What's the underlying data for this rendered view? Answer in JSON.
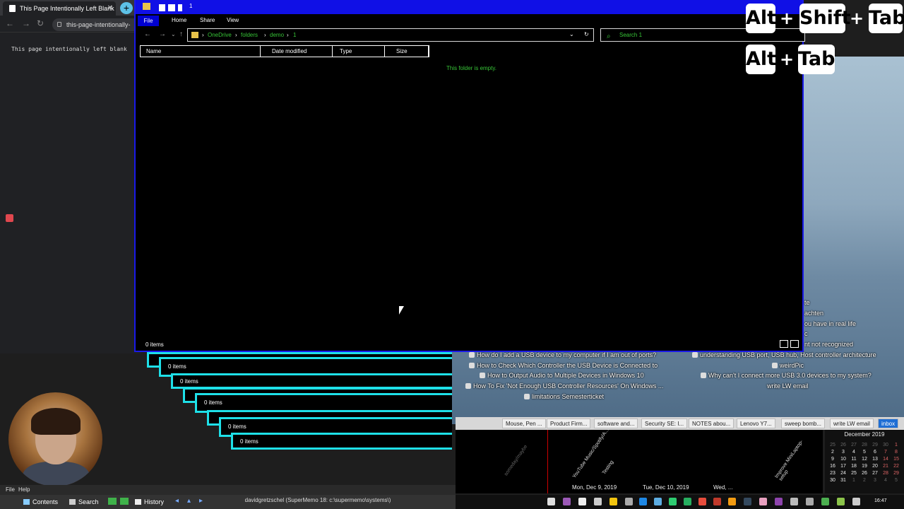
{
  "browser": {
    "tab_title": "This Page Intentionally Left Blank",
    "new_tab_symbol": "+",
    "url": "this-page-intentionally-",
    "content_text": "This page intentionally left blank"
  },
  "explorer": {
    "title_number": "1",
    "ribbon_tabs": [
      "File",
      "Home",
      "Share",
      "View"
    ],
    "breadcrumb": [
      "OneDrive",
      "folders",
      "demo",
      "1"
    ],
    "search_placeholder": "Search 1",
    "columns": [
      "Name",
      "Date modified",
      "Type",
      "Size"
    ],
    "empty_message": "This folder is empty.",
    "status": "0 items"
  },
  "cascade_status": [
    "0 items",
    "0 items",
    "0 items",
    "0 items",
    "0 items"
  ],
  "key_overlay": {
    "row1": [
      "Alt",
      "+",
      "Shift",
      "+",
      "Tab"
    ],
    "row2": [
      "Alt",
      "+",
      "Tab"
    ]
  },
  "wallpaper_links": [
    "How do I add a USB device to my computer if I am out of ports?",
    "How to Check Which Controller the USB Device is Connected to",
    "How to Output Audio to Multiple Devices in Windows 10",
    "How To Fix 'Not Enough USB Controller Resources' On Windows ...",
    "limitations Semesterticket",
    "understanding USB port, USB hub, Host controller architecture",
    "weirdPic",
    "Why can't I connect more USB 3.0 devices to my system?",
    "write LW email",
    "te",
    "achten",
    "ou have in real life",
    "c",
    "nt not recognized"
  ],
  "bookmark_bar": [
    "Mouse, Pen ...",
    "Product Firm...",
    "software and...",
    "Security SE: I...",
    "NOTES abou...",
    "Lenovo Y7...",
    "sweep bomb...",
    "write LW email",
    "inbox"
  ],
  "timeline": {
    "labels": [
      "Mon, Dec 9, 2019",
      "Tue, Dec 10, 2019",
      "Wed, ..."
    ],
    "tasks": [
      "someday/maybe",
      "YouTube Music/Spotify/A...",
      "Testing",
      "Improve MiniLaptop-setup"
    ]
  },
  "calendar": {
    "title": "December 2019",
    "rows": [
      [
        "25",
        "26",
        "27",
        "28",
        "29",
        "30",
        "1"
      ],
      [
        "2",
        "3",
        "4",
        "5",
        "6",
        "7",
        "8"
      ],
      [
        "9",
        "10",
        "11",
        "12",
        "13",
        "14",
        "15"
      ],
      [
        "16",
        "17",
        "18",
        "19",
        "20",
        "21",
        "22"
      ],
      [
        "23",
        "24",
        "25",
        "26",
        "27",
        "28",
        "29"
      ],
      [
        "30",
        "31",
        "1",
        "2",
        "3",
        "4",
        "5"
      ]
    ]
  },
  "supermemo": {
    "menu": [
      "File",
      "Help"
    ],
    "buttons": [
      "Contents",
      "Search",
      "History"
    ],
    "status": "davidgretzschel (SuperMemo 18: c:\\supermemo\\systems\\)"
  },
  "clock": "16:47",
  "colors": {
    "explorer_border": "#1a1ae8",
    "cascade_border": "#1ee0e8",
    "explorer_text_accent": "#37c537"
  }
}
